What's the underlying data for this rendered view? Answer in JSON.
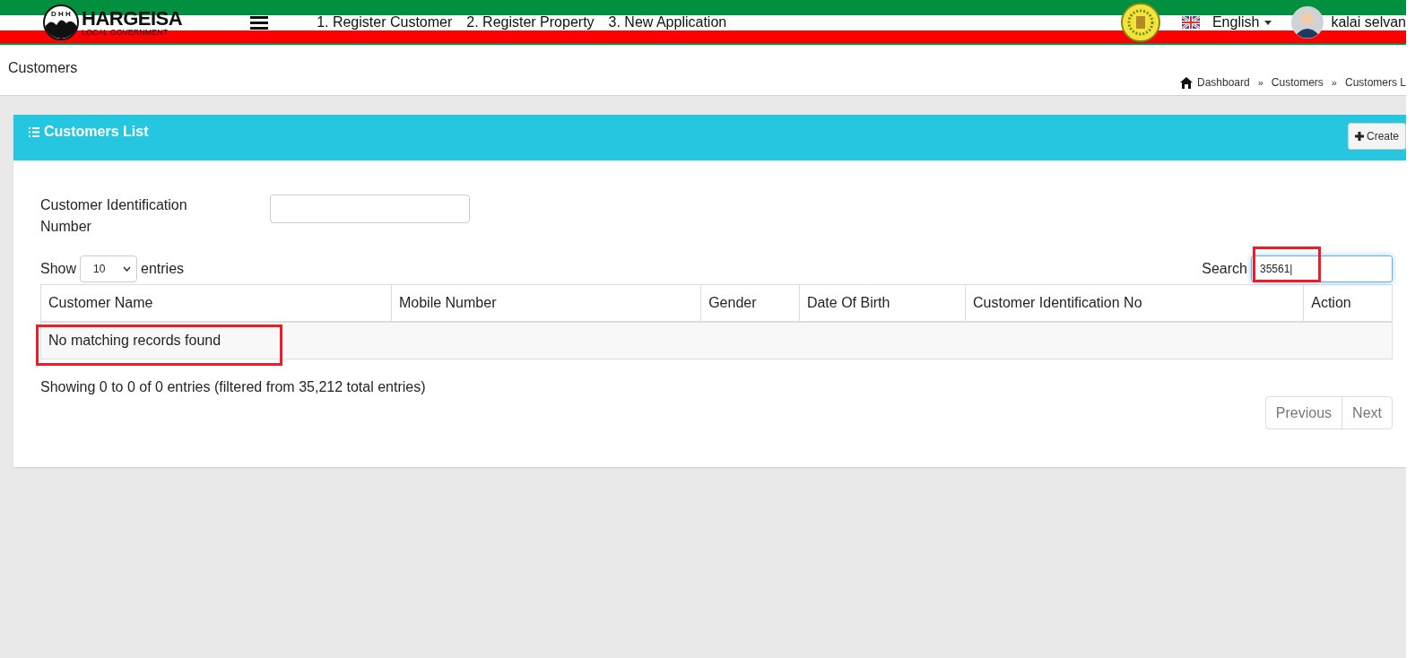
{
  "header": {
    "logo": {
      "name": "HARGEISA",
      "subtitle": "LOCAL GOVERNMENT",
      "initials": "D H H"
    },
    "nav": [
      "1. Register Customer",
      "2. Register Property",
      "3. New Application"
    ],
    "language": "English",
    "user": "kalai selvan"
  },
  "page": {
    "title": "Customers",
    "breadcrumb": [
      "Dashboard",
      "»",
      "Customers",
      "»",
      "Customers L"
    ]
  },
  "card": {
    "title": "Customers List",
    "create_button": "Create",
    "filter": {
      "label": "Customer Identification Number"
    },
    "length": {
      "before": "Show",
      "value": "10",
      "after": "entries"
    },
    "search": {
      "label": "Search",
      "value": "35561|",
      "highlighted": true
    },
    "table": {
      "columns": [
        "Customer Name",
        "Mobile Number",
        "Gender",
        "Date Of Birth",
        "Customer Identification No",
        "Action"
      ],
      "empty_message": "No matching records found",
      "empty_highlighted": true
    },
    "info": "Showing 0 to 0 of 0 entries (filtered from 35,212 total entries)",
    "pagination": [
      {
        "label": "Previous",
        "disabled": true
      },
      {
        "label": "Next",
        "disabled": true
      }
    ]
  }
}
